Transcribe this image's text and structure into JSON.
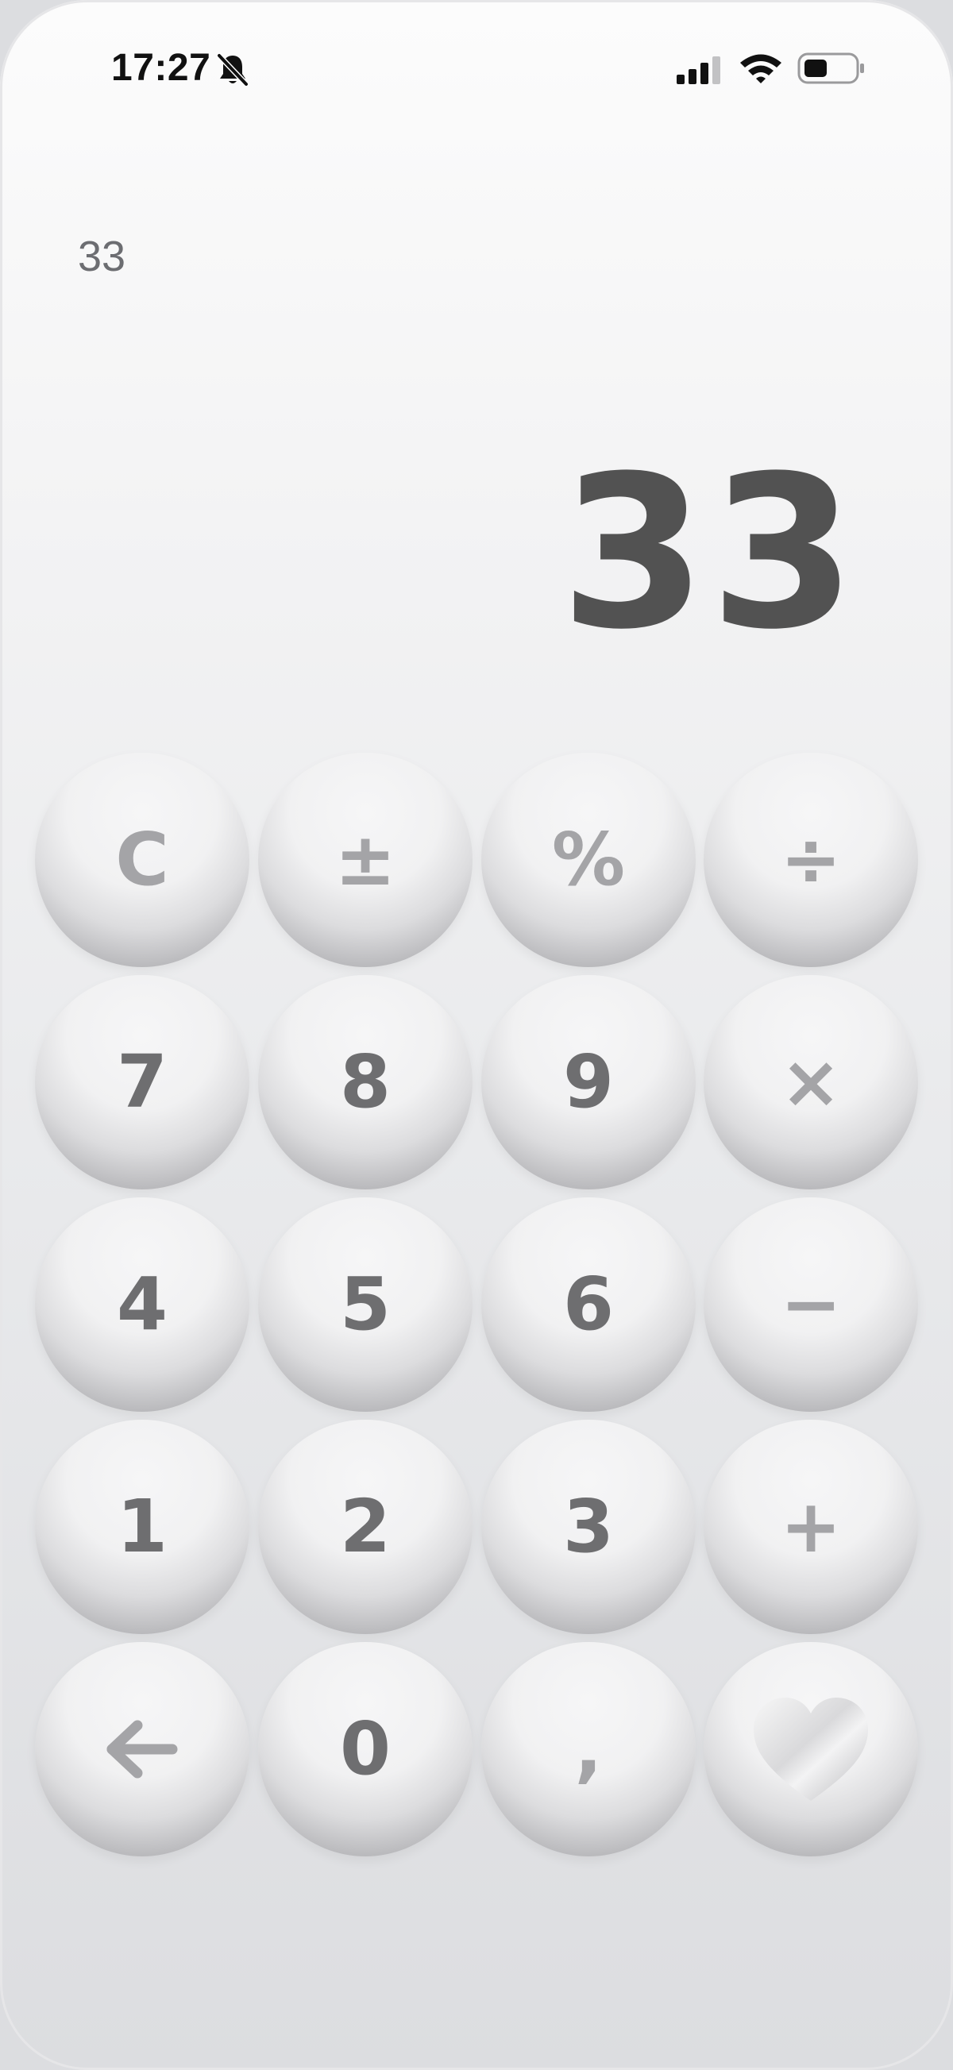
{
  "status_bar": {
    "time": "17:27",
    "icons": [
      "bell-slash-icon",
      "signal-icon",
      "wifi-icon",
      "battery-icon"
    ]
  },
  "display": {
    "history": "33",
    "value": "33"
  },
  "keypad": {
    "rows": [
      [
        "C",
        "±",
        "%",
        "÷"
      ],
      [
        "7",
        "8",
        "9",
        "×"
      ],
      [
        "4",
        "5",
        "6",
        "−"
      ],
      [
        "1",
        "2",
        "3",
        "+"
      ],
      [
        "backspace-icon",
        "0",
        ",",
        "heart-icon"
      ]
    ]
  },
  "colors": {
    "digit": "#6e6e70",
    "function": "#a4a4a7",
    "display_value": "#525252",
    "history": "#6c6d71"
  }
}
